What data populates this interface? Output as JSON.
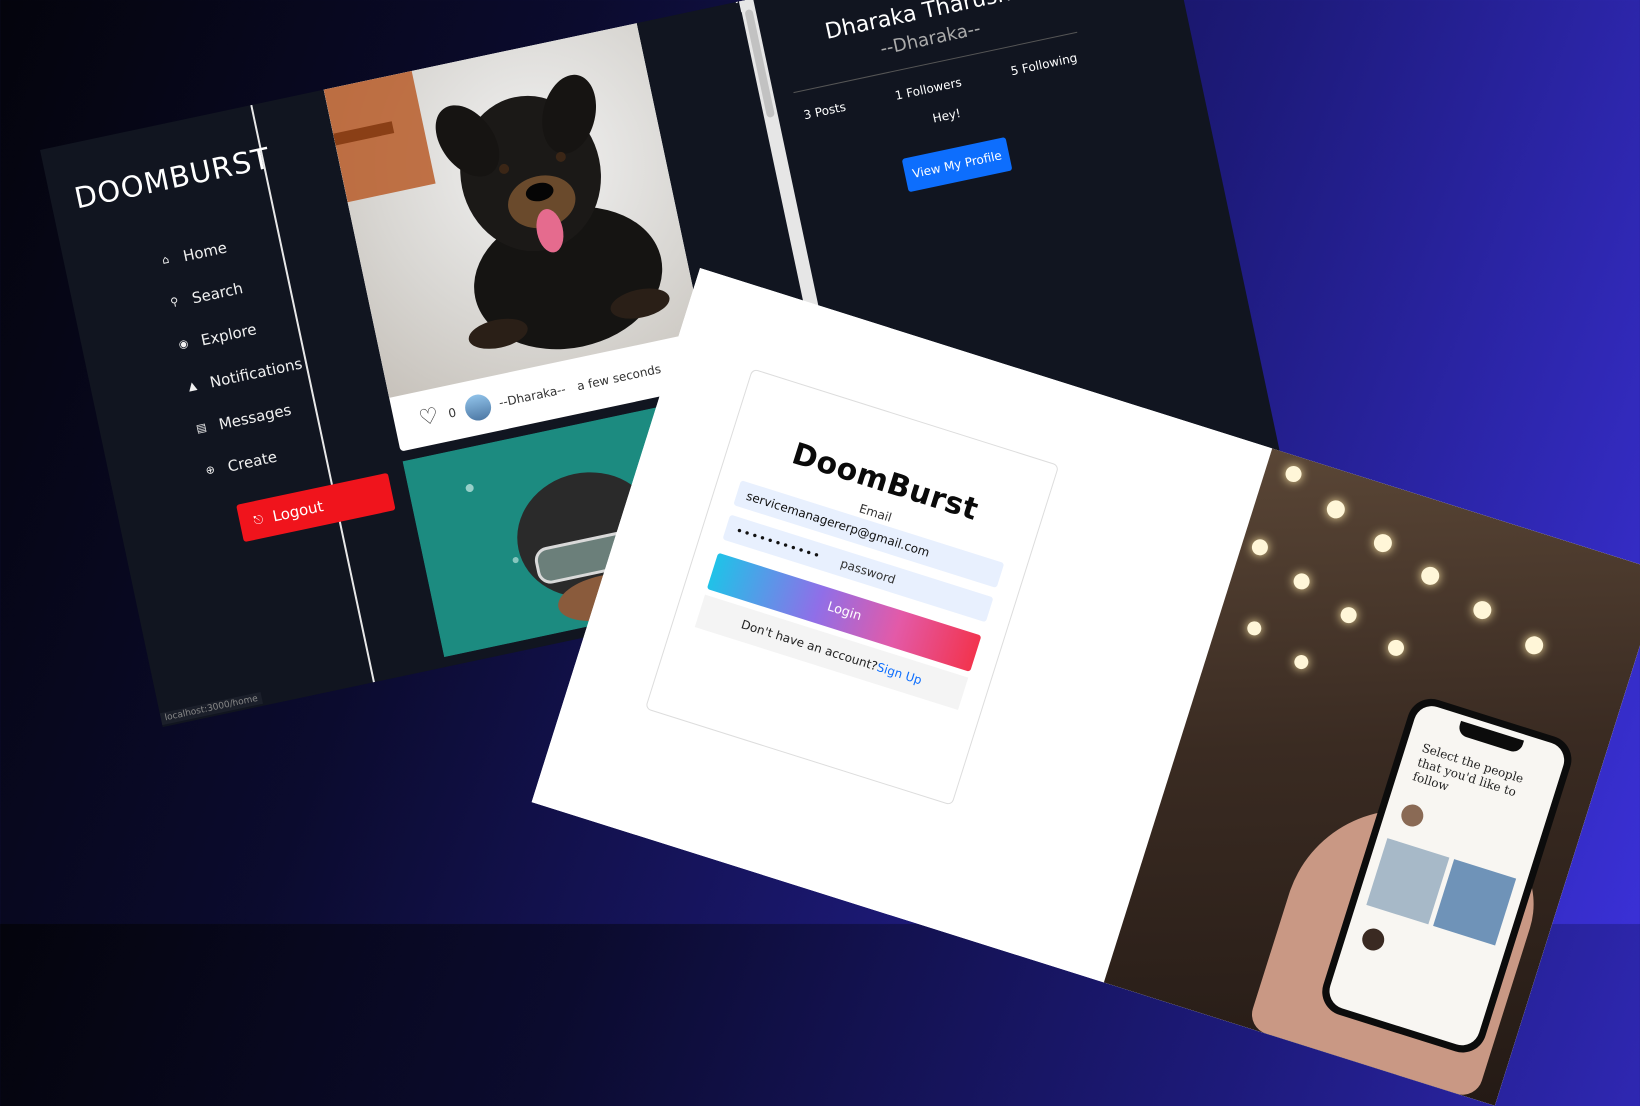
{
  "dashboard": {
    "brand": "DOOMBURST",
    "nav": [
      {
        "icon": "home-icon",
        "glyph": "⌂",
        "label": "Home"
      },
      {
        "icon": "search-icon",
        "glyph": "⚲",
        "label": "Search"
      },
      {
        "icon": "compass-icon",
        "glyph": "◉",
        "label": "Explore"
      },
      {
        "icon": "bell-icon",
        "glyph": "▲",
        "label": "Notifications"
      },
      {
        "icon": "message-icon",
        "glyph": "▤",
        "label": "Messages"
      },
      {
        "icon": "plus-circle-icon",
        "glyph": "⊕",
        "label": "Create"
      }
    ],
    "logout_label": "Logout",
    "status_url": "localhost:3000/home",
    "post": {
      "likes": "0",
      "author": "--Dharaka--",
      "time": "a few seconds"
    },
    "profile": {
      "name": "Dharaka Tharusha",
      "handle": "--Dharaka--",
      "posts": "3 Posts",
      "followers": "1 Followers",
      "following": "5 Following",
      "bio": "Hey!",
      "button": "View My Profile"
    }
  },
  "login": {
    "logo": "DoomBurst",
    "email_label": "Email",
    "email_value": "servicemanagererp@gmail.com",
    "password_mask": "•••••••••••",
    "password_placeholder": "password",
    "login_button": "Login",
    "signup_prompt": "Don't have an account?",
    "signup_link": "Sign Up",
    "phone_text": "Select the people that you'd like to follow"
  }
}
